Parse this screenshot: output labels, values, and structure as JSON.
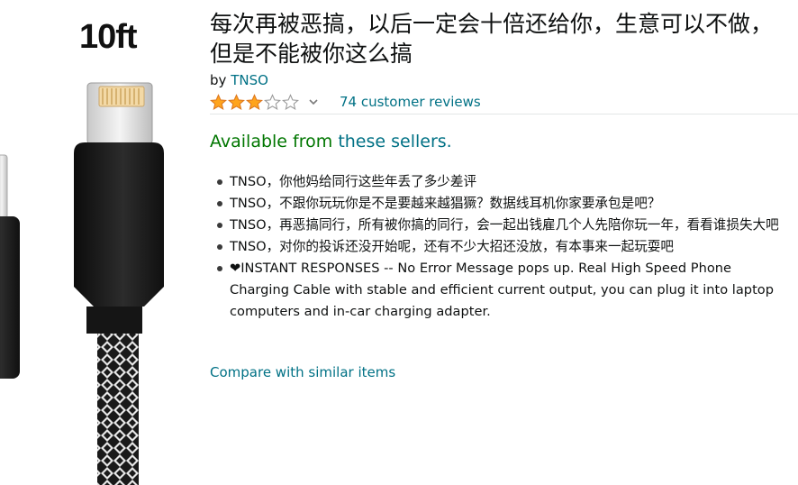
{
  "product_image": {
    "length_label": "10ft"
  },
  "product": {
    "title": "每次再被恶搞，以后一定会十倍还给你，生意可以不做，但是不能被你这么搞",
    "by_prefix": "by",
    "brand": "TNSO",
    "rating_stars": 3,
    "rating_max": 5,
    "star_color": "#ffa41c",
    "review_link": "74 customer reviews",
    "availability_prefix": "Available from",
    "availability_link": "these sellers.",
    "bullets": [
      "TNSO，你他妈给同行这些年丢了多少差评",
      "TNSO，不跟你玩玩你是不是要越来越猖獗？数据线耳机你家要承包是吧？",
      "TNSO，再恶搞同行，所有被你搞的同行，会一起出钱雇几个人先陪你玩一年，看看谁损失大吧",
      "TNSO，对你的投诉还没开始呢，还有不少大招还没放，有本事来一起玩耍吧",
      "❤INSTANT RESPONSES -- No Error Message pops up. Real High Speed Phone Charging Cable with stable and efficient current output, you can plug it into laptop computers and in-car charging adapter."
    ],
    "compare_link": "Compare with similar items"
  },
  "colors": {
    "link": "#007185",
    "availability_green": "#007600",
    "text": "#0f1111"
  }
}
